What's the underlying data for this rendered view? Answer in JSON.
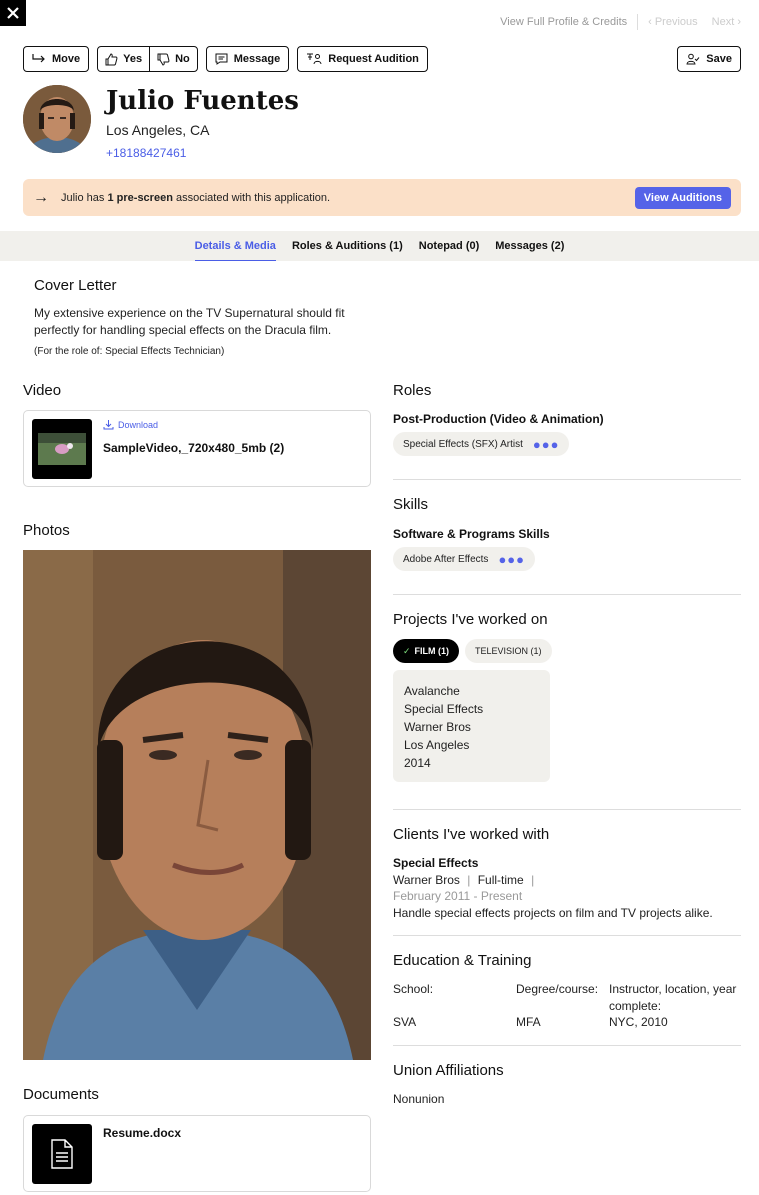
{
  "topnav": {
    "full_profile": "View Full Profile & Credits",
    "previous": "‹ Previous",
    "next": "Next ›"
  },
  "actions": {
    "move": "Move",
    "yes": "Yes",
    "no": "No",
    "message": "Message",
    "request_audition": "Request Audition",
    "save": "Save"
  },
  "profile": {
    "name": "Julio Fuentes",
    "location": "Los Angeles, CA",
    "phone": "+18188427461"
  },
  "banner": {
    "prefix": "Julio has ",
    "count": "1 pre-screen",
    "suffix": " associated with this application.",
    "button": "View Auditions"
  },
  "tabs": [
    {
      "label": "Details & Media"
    },
    {
      "label": "Roles & Auditions (1)"
    },
    {
      "label": "Notepad (0)"
    },
    {
      "label": "Messages (2)"
    }
  ],
  "cover_letter": {
    "title": "Cover Letter",
    "text": "My extensive experience on the TV Supernatural should fit perfectly for handling special effects on the Dracula film.",
    "role_note": "(For the role of: Special Effects Technician)"
  },
  "video": {
    "title": "Video",
    "download": "Download",
    "filename": "SampleVideo,_720x480_5mb (2)"
  },
  "photos": {
    "title": "Photos"
  },
  "documents": {
    "title": "Documents",
    "filename": "Resume.docx"
  },
  "roles": {
    "title": "Roles",
    "category": "Post-Production (Video & Animation)",
    "pill": "Special Effects (SFX) Artist"
  },
  "skills": {
    "title": "Skills",
    "category": "Software & Programs Skills",
    "pill": "Adobe After Effects"
  },
  "projects": {
    "title": "Projects I've worked on",
    "tab_film": "FILM (1)",
    "tab_tv": "TELEVISION (1)",
    "item": [
      "Avalanche",
      "Special Effects",
      "Warner Bros",
      "Los Angeles",
      "2014"
    ]
  },
  "clients": {
    "title": "Clients I've worked with",
    "role": "Special Effects",
    "company": "Warner Bros",
    "type": "Full-time",
    "dates": "February 2011 - Present",
    "description": "Handle special effects projects on film and TV projects alike."
  },
  "education": {
    "title": "Education & Training",
    "school_label": "School:",
    "degree_label": "Degree/course:",
    "instructor_label": "Instructor, location, year complete:",
    "school": "SVA",
    "degree": "MFA",
    "instructor": "NYC, 2010"
  },
  "union": {
    "title": "Union Affiliations",
    "value": "Nonunion"
  },
  "colors": {
    "accent": "#5563e8",
    "banner": "#fbe0c8",
    "tabbar": "#f1f0ec"
  }
}
